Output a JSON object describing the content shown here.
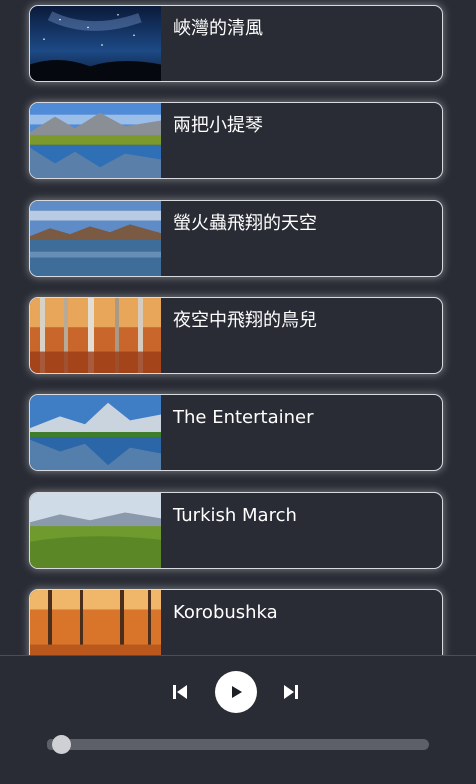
{
  "playlist": {
    "items": [
      {
        "title": "峽灣的清風",
        "image": "night-sky-milky-way"
      },
      {
        "title": "兩把小提琴",
        "image": "mountain-lake-reflection"
      },
      {
        "title": "螢火蟲飛翔的天空",
        "image": "calm-lake-at-dusk"
      },
      {
        "title": "夜空中飛翔的鳥兒",
        "image": "autumn-forest"
      },
      {
        "title": "The Entertainer",
        "image": "alpine-lake-peak"
      },
      {
        "title": "Turkish March",
        "image": "green-hills"
      },
      {
        "title": "Korobushka",
        "image": "autumn-tree-path"
      }
    ]
  },
  "player": {
    "prev_icon": "skip-previous-icon",
    "play_icon": "play-icon",
    "next_icon": "skip-next-icon",
    "progress": 0.02
  },
  "colors": {
    "background": "#292c35",
    "card_border": "#d9dae0",
    "track": "#5e6069",
    "knob": "#cfd0d4"
  }
}
